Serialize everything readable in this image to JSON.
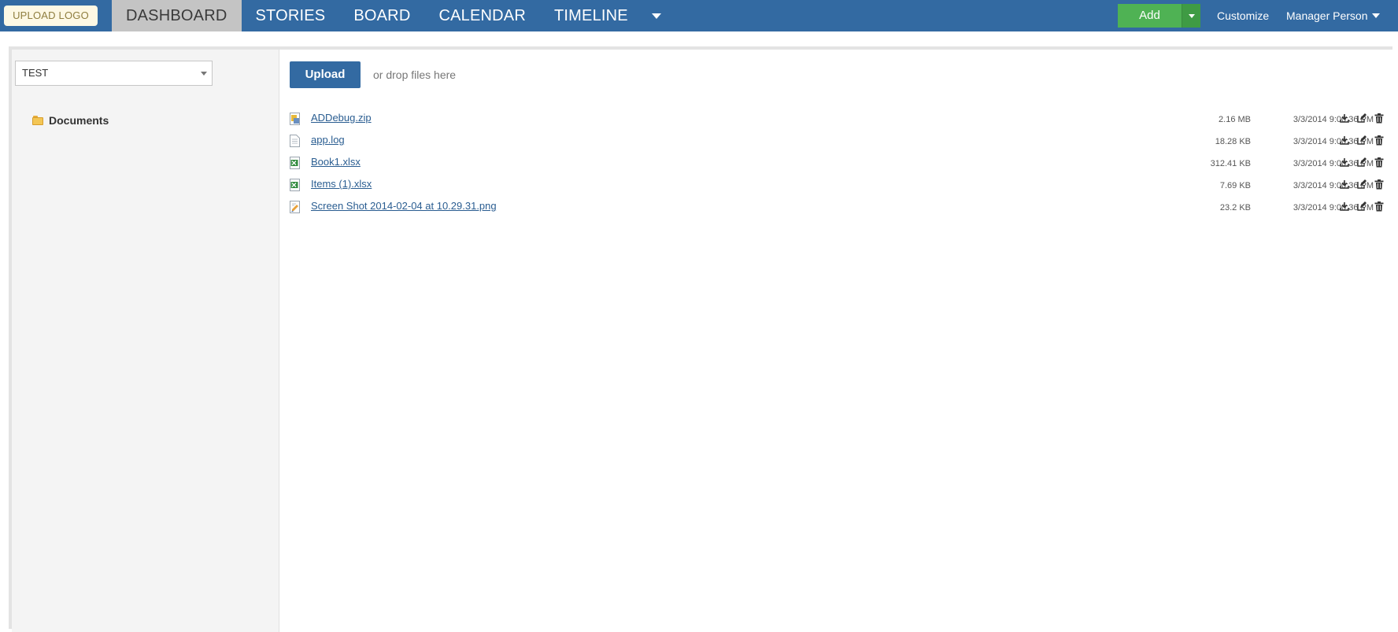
{
  "header": {
    "logo_label": "UPLOAD LOGO",
    "tabs": [
      {
        "label": "DASHBOARD",
        "active": true
      },
      {
        "label": "STORIES",
        "active": false
      },
      {
        "label": "BOARD",
        "active": false
      },
      {
        "label": "CALENDAR",
        "active": false
      },
      {
        "label": "TIMELINE",
        "active": false
      }
    ],
    "more_icon": "chevron-down-icon",
    "add_label": "Add",
    "customize_label": "Customize",
    "user_label": "Manager Person"
  },
  "sidebar": {
    "select_value": "TEST",
    "folder_label": "Documents"
  },
  "main": {
    "upload_label": "Upload",
    "drop_text": "or drop files here",
    "files": [
      {
        "name": "ADDebug.zip",
        "size": "2.16 MB",
        "date": "3/3/2014 9:00:36 PM",
        "icon": "zip-file-icon"
      },
      {
        "name": "app.log",
        "size": "18.28 KB",
        "date": "3/3/2014 9:00:36 PM",
        "icon": "text-file-icon"
      },
      {
        "name": "Book1.xlsx",
        "size": "312.41 KB",
        "date": "3/3/2014 9:00:36 PM",
        "icon": "excel-file-icon"
      },
      {
        "name": "Items (1).xlsx",
        "size": "7.69 KB",
        "date": "3/3/2014 9:00:36 PM",
        "icon": "excel-file-icon"
      },
      {
        "name": "Screen Shot 2014-02-04 at 10.29.31.png",
        "size": "23.2 KB",
        "date": "3/3/2014 9:00:36 PM",
        "icon": "image-file-icon"
      }
    ]
  },
  "colors": {
    "nav_bar": "#336aa2",
    "active_tab": "#c4c4c4",
    "add_button": "#4fb254",
    "link": "#2a5d91"
  }
}
